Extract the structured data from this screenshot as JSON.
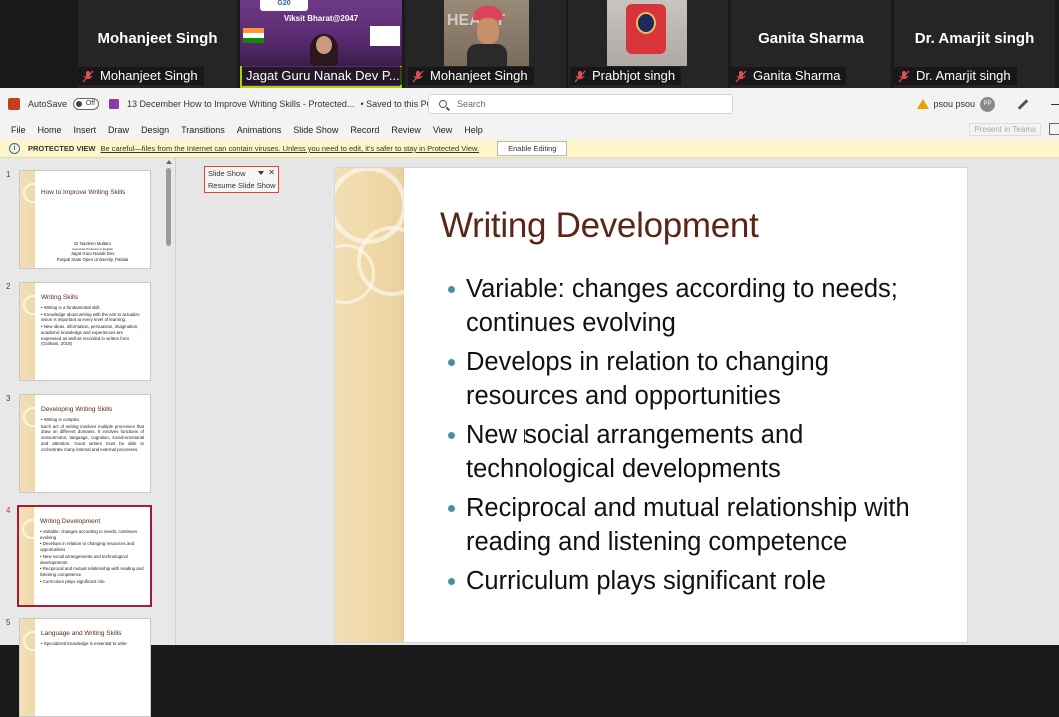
{
  "video_strip": {
    "tiles": [
      {
        "big_name": "Mohanjeet Singh",
        "label": "Mohanjeet Singh"
      },
      {
        "big_name": "",
        "label": "Jagat Guru Nanak Dev P...",
        "overlay_text": "Viksit Bharat@2047"
      },
      {
        "big_name": "",
        "label": "Mohanjeet Singh"
      },
      {
        "big_name": "",
        "label": "Prabhjot singh"
      },
      {
        "big_name": "Ganita Sharma",
        "label": "Ganita Sharma"
      },
      {
        "big_name": "Dr. Amarjit singh",
        "label": "Dr. Amarjit singh"
      }
    ]
  },
  "titlebar": {
    "autosave": "AutoSave",
    "toggle_state": "Off",
    "doc_title": "13 December How to Improve Writing Skills  -  Protected...",
    "saved_status": "• Saved to this PC",
    "search_placeholder": "Search",
    "user_name": "psou psou",
    "user_initials": "PP"
  },
  "menubar": {
    "items": [
      "File",
      "Home",
      "Insert",
      "Draw",
      "Design",
      "Transitions",
      "Animations",
      "Slide Show",
      "Record",
      "Review",
      "View",
      "Help"
    ],
    "present_teams": "Present in Teams"
  },
  "protected_view": {
    "title": "PROTECTED VIEW",
    "message": "Be careful—files from the Internet can contain viruses. Unless you need to edit, it's safer to stay in Protected View.",
    "button": "Enable Editing"
  },
  "slideshow_toolbar": {
    "title": "Slide Show",
    "resume": "Resume Slide Show"
  },
  "thumbnails": [
    {
      "num": "1",
      "title": "How to Improve Writing Skills",
      "center_lines": [
        "Dr Navleen Multani",
        "Associate Professor in English",
        "Jagat Guru Nanak Dev",
        "Punjab State Open University, Patiala"
      ]
    },
    {
      "num": "2",
      "title": "Writing Skills",
      "bullets": [
        "• Writing is a fundamental skill.",
        "• Knowledge about writing with the aim to actualize vision is important at every level of learning.",
        "• New ideas, information, persuasion, imagination, academic knowledge and experiences are expressed as well as recorded in written form (Graham, 2018)"
      ]
    },
    {
      "num": "3",
      "title": "Developing Writing Skills",
      "bullets": [
        "• Writing is complex",
        "Each act of writing involves multiple processes that draw on different domains. It involves functions of sensorimotor, language, cognition, social-emotional and attention. Good writers must be able to orchestrate many internal and external processes."
      ]
    },
    {
      "num": "4",
      "title": "Writing Development",
      "bullets": [
        "• Variable: changes according to needs; continues evolving",
        "• Develops in relation to changing resources and opportunities",
        "• New social arrangements and technological developments",
        "• Reciprocal and mutual relationship with reading and listening competence",
        "• Curriculum plays significant role"
      ]
    },
    {
      "num": "5",
      "title": "Language and Writing Skills",
      "bullets": [
        "• Specialized knowledge is essential to write"
      ]
    }
  ],
  "slide": {
    "title": "Writing Development",
    "bullets": [
      "Variable: changes according to needs; continues evolving",
      "Develops in relation to changing resources and opportunities",
      "New social arrangements and technological developments",
      "Reciprocal and mutual relationship with reading and listening competence",
      "Curriculum plays significant role"
    ]
  },
  "colors": {
    "accent_title": "#5b2517",
    "bullet_dot": "#4a8f9e",
    "selected_thumb_border": "#a01e36",
    "active_speaker": "#a8d400"
  }
}
